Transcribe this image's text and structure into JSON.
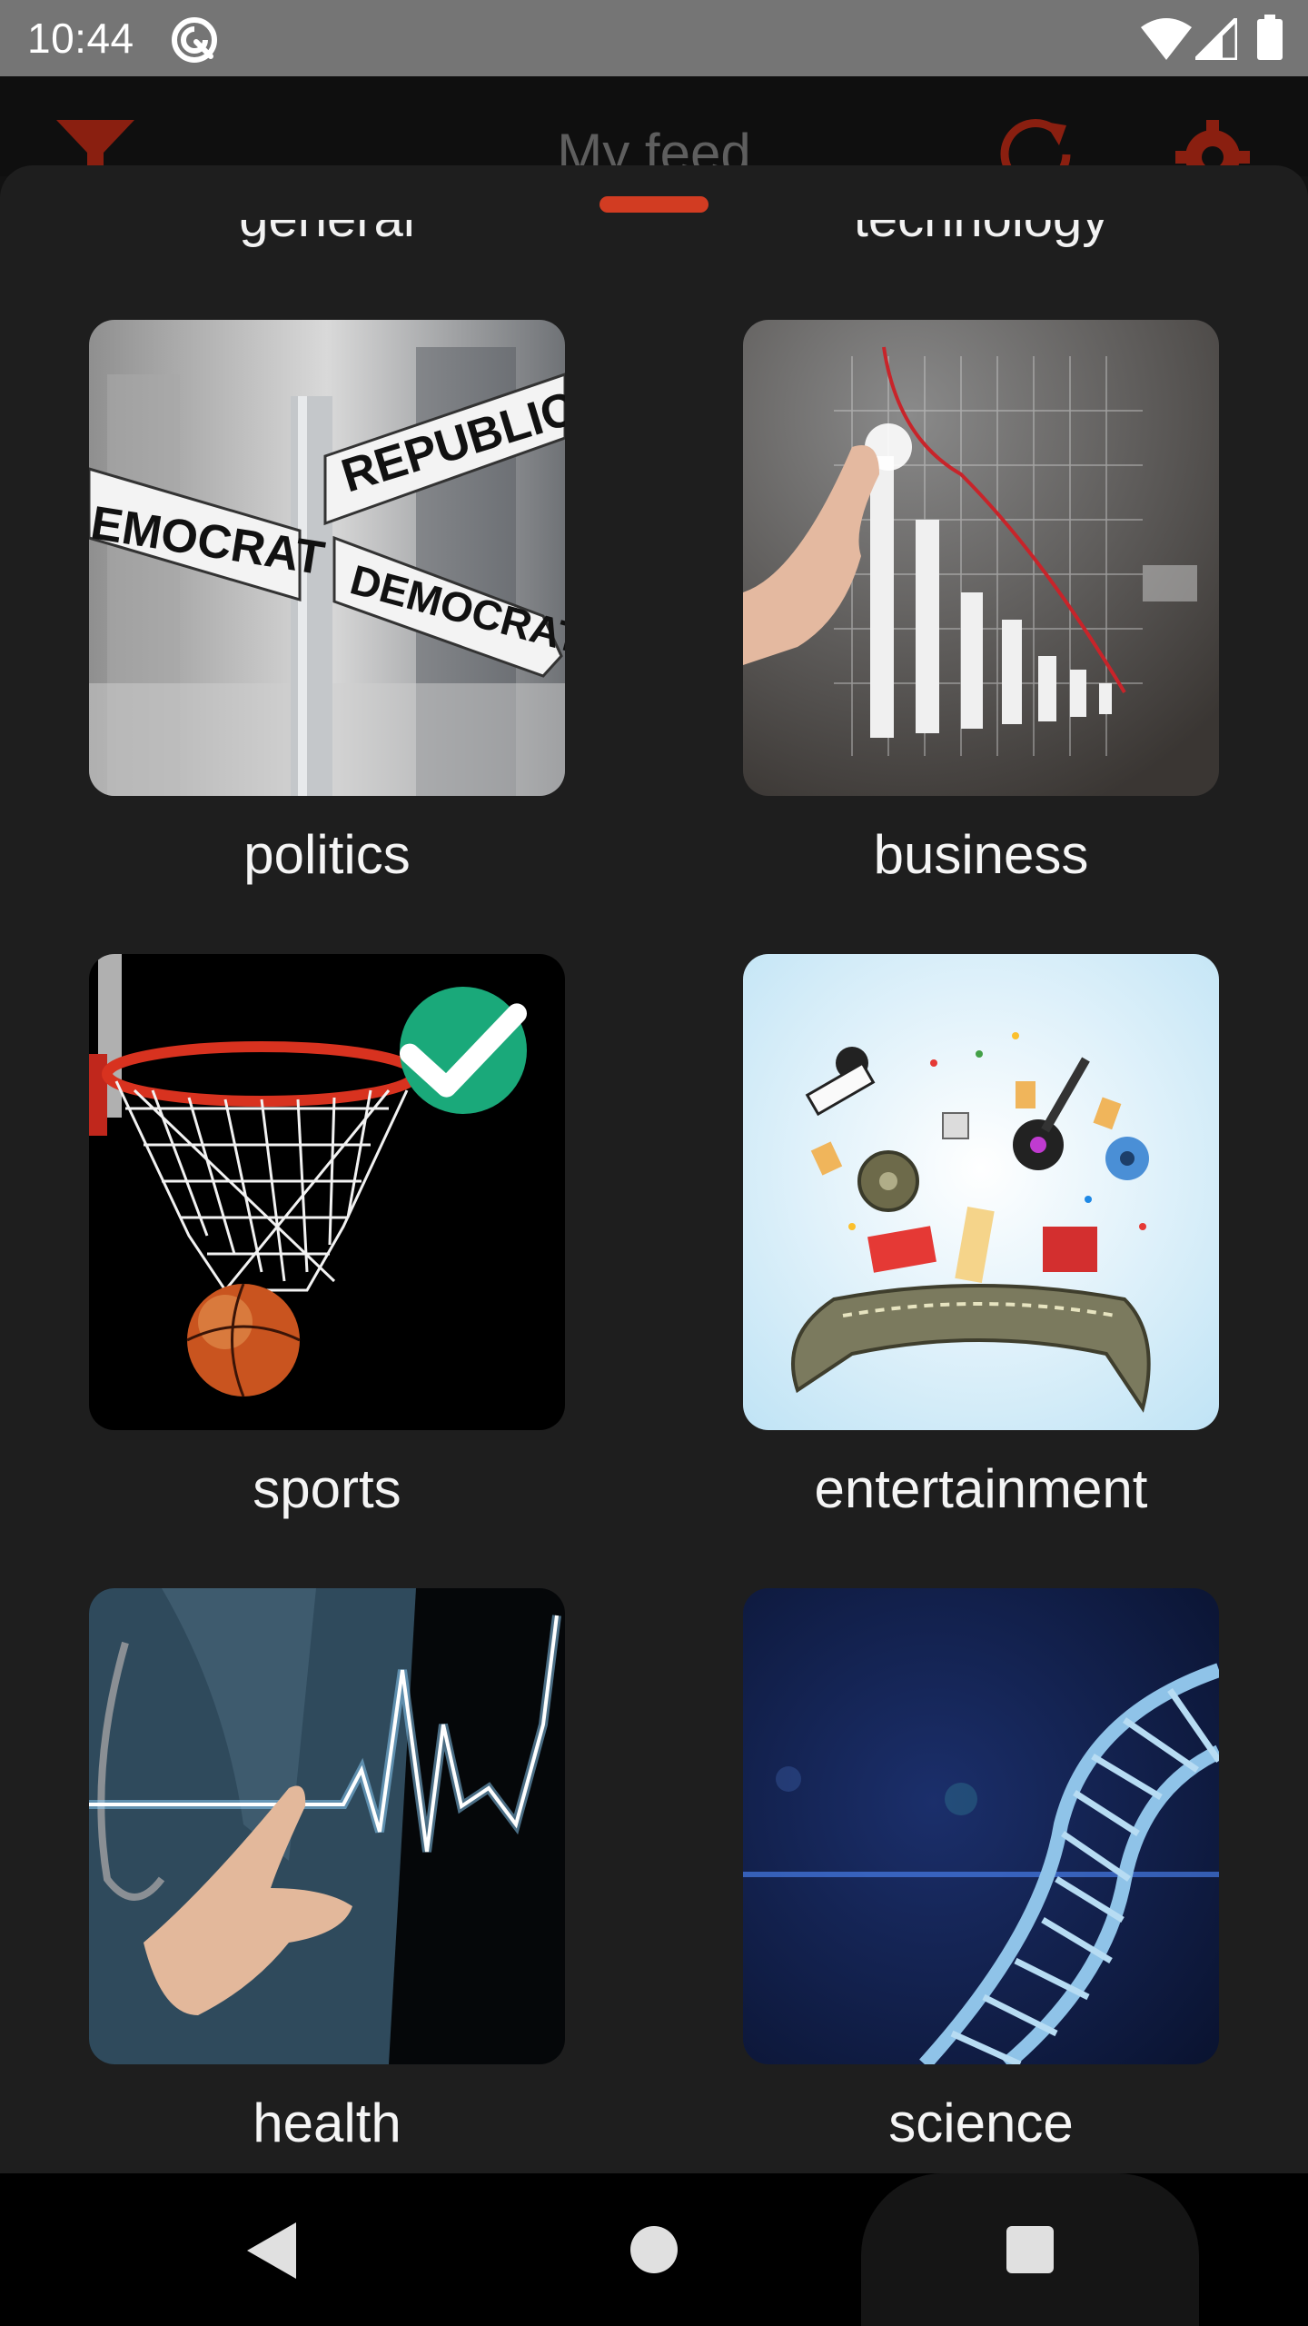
{
  "status_bar": {
    "time": "10:44",
    "icons": [
      "sync-icon",
      "wifi-icon",
      "signal-icon",
      "battery-icon"
    ]
  },
  "app_bar": {
    "title": "My feed",
    "icons": [
      "filter-icon",
      "refresh-icon",
      "settings-icon"
    ],
    "accent_color": "#d23c22"
  },
  "sheet": {
    "clipped_labels": [
      "general",
      "technology"
    ],
    "categories": [
      {
        "label": "politics",
        "selected": false
      },
      {
        "label": "business",
        "selected": false
      },
      {
        "label": "sports",
        "selected": true
      },
      {
        "label": "entertainment",
        "selected": false
      },
      {
        "label": "health",
        "selected": false
      },
      {
        "label": "science",
        "selected": false
      }
    ],
    "selected_color": "#1aa97a"
  },
  "nav_bar": {
    "buttons": [
      "back",
      "home",
      "recents"
    ]
  }
}
